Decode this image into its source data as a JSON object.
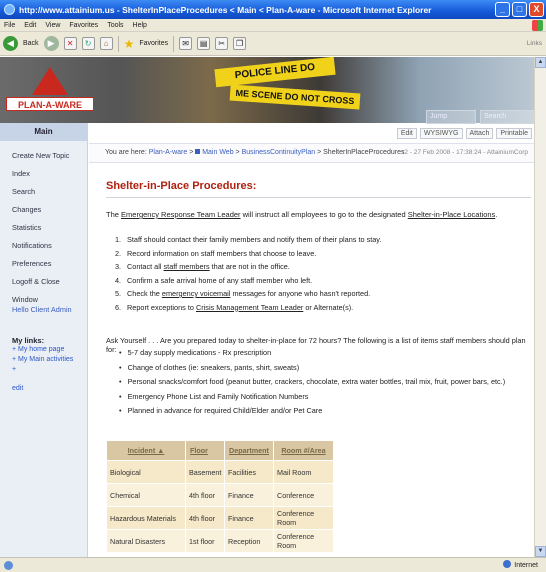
{
  "window": {
    "title": "http://www.attainium.us - ShelterInPlaceProcedures < Main < Plan-A-ware - Microsoft Internet Explorer",
    "controls": [
      "_",
      "□",
      "X"
    ]
  },
  "menubar": [
    "File",
    "Edit",
    "View",
    "Favorites",
    "Tools",
    "Help"
  ],
  "toolbar": {
    "back_label": "Back",
    "favorites_label": "Favorites",
    "links_label": "Links"
  },
  "banner": {
    "logo_text": "PLAN-A-WARE",
    "tape_text_1": "POLICE LINE DO",
    "tape_text_2": "ME SCENE DO NOT CROSS",
    "jump_placeholder": "Jump",
    "search_placeholder": "Search"
  },
  "sidebar": {
    "heading": "Main",
    "links": [
      "Create New Topic",
      "Index",
      "Search",
      "Changes",
      "Statistics",
      "Notifications",
      "Preferences",
      "Logoff & Close Window"
    ],
    "hello": "Hello Client Admin",
    "my_links_title": "My links:",
    "my_links": [
      "+ My home page",
      "+ My Main activities",
      "+"
    ],
    "edit": "edit"
  },
  "actions": [
    "Edit",
    "WYSIWYG",
    "Attach",
    "Printable"
  ],
  "breadcrumb": {
    "prefix": "You are here:",
    "items": [
      "Plan-A-ware",
      "Main Web",
      "BusinessContinuityPlan",
      "ShelterInPlaceProcedures"
    ],
    "seps": [
      ">",
      ">",
      ">"
    ],
    "date": "r2 - 27 Feb 2008 - 17:38:24 - AttainiumCorp"
  },
  "page": {
    "title": "Shelter-in-Place Procedures:",
    "intro": {
      "pre": "The",
      "link1": "Emergency Response Team Leader",
      "mid": "will instruct all employees to go to the designated",
      "link2": "Shelter-in-Place Locations",
      "end": "."
    },
    "steps": [
      {
        "num": "1.",
        "pre": "Staff should contact their family members and notify them of their plans to stay.",
        "link": "",
        "post": ""
      },
      {
        "num": "2.",
        "pre": "Record information on staff members that choose to leave.",
        "link": "",
        "post": ""
      },
      {
        "num": "3.",
        "pre": "Contact all",
        "link": "staff members",
        "post": "that are not in the office."
      },
      {
        "num": "4.",
        "pre": "Confirm a safe arrival home of any staff member who left.",
        "link": "",
        "post": ""
      },
      {
        "num": "5.",
        "pre": "Check the",
        "link": "emergency voicemail",
        "post": "messages for anyone who hasn't reported."
      },
      {
        "num": "6.",
        "pre": "Report exceptions to",
        "link": "Crisis Management Team Leader",
        "post": "or Alternate(s)."
      }
    ],
    "ask": "Ask Yourself . . . Are you prepared today to shelter-in-place for 72 hours? The following is a list of items staff members should plan for:",
    "items": [
      "5-7 day supply medications - Rx prescription",
      "Change of clothes (ie: sneakers, pants, shirt, sweats)",
      "Personal snacks/comfort food (peanut butter, crackers, chocolate, extra water bottles, trail mix, fruit, power bars, etc.)",
      "Emergency Phone List and Family Notification Numbers",
      "Planned in advance for required Child/Elder and/or Pet Care"
    ],
    "table": {
      "headers": [
        "Incident ▲",
        "Floor",
        "Department",
        "Room #/Area"
      ],
      "rows": [
        [
          "Biological",
          "Basement",
          "Facilities",
          "Mail Room"
        ],
        [
          "Chemical",
          "4th floor",
          "Finance",
          "Conference"
        ],
        [
          "Hazardous Materials",
          "4th floor",
          "Finance",
          "Conference Room"
        ],
        [
          "Natural Disasters",
          "1st floor",
          "Reception",
          "Conference Room"
        ]
      ]
    }
  },
  "status": {
    "zone": "Internet"
  }
}
